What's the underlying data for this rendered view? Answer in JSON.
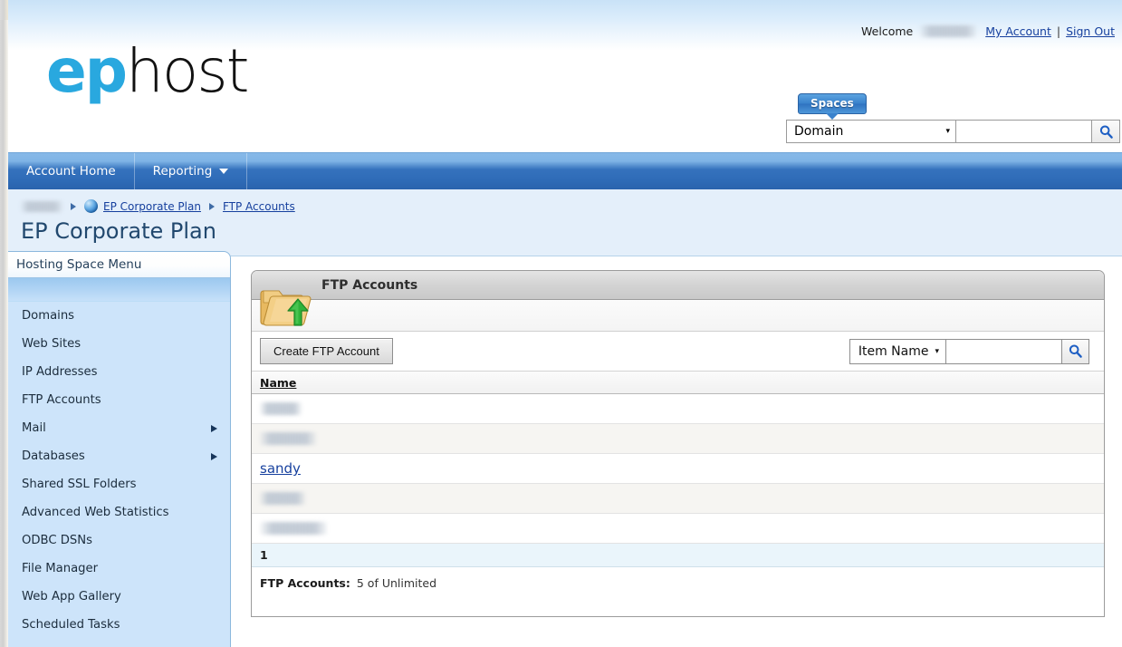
{
  "header": {
    "welcome_label": "Welcome",
    "welcome_user_redacted": "",
    "my_account_label": "My Account",
    "separator": "|",
    "sign_out_label": "Sign Out",
    "logo_part1": "ep",
    "logo_part2": "host",
    "brand_blue": "#29a8df"
  },
  "global_search": {
    "tab_label": "Spaces",
    "scope_value": "Domain",
    "scope_caret": "▾",
    "query_value": "",
    "query_placeholder": "",
    "search_icon": "magnifier-icon"
  },
  "nav": {
    "items": [
      {
        "label": "Account Home",
        "has_caret": false
      },
      {
        "label": "Reporting",
        "has_caret": true
      }
    ]
  },
  "breadcrumb": {
    "root_redacted": "",
    "globe_icon": "globe-icon",
    "items": [
      {
        "label": "EP Corporate Plan"
      },
      {
        "label": "FTP Accounts"
      }
    ]
  },
  "page_title": "EP Corporate Plan",
  "sidebar": {
    "title": "Hosting Space Menu",
    "items": [
      {
        "label": "Domains",
        "has_submenu": false
      },
      {
        "label": "Web Sites",
        "has_submenu": false
      },
      {
        "label": "IP Addresses",
        "has_submenu": false
      },
      {
        "label": "FTP Accounts",
        "has_submenu": false
      },
      {
        "label": "Mail",
        "has_submenu": true
      },
      {
        "label": "Databases",
        "has_submenu": true
      },
      {
        "label": "Shared SSL Folders",
        "has_submenu": false
      },
      {
        "label": "Advanced Web Statistics",
        "has_submenu": false
      },
      {
        "label": "ODBC DSNs",
        "has_submenu": false
      },
      {
        "label": "File Manager",
        "has_submenu": false
      },
      {
        "label": "Web App Gallery",
        "has_submenu": false
      },
      {
        "label": "Scheduled Tasks",
        "has_submenu": false
      }
    ]
  },
  "panel": {
    "title": "FTP Accounts",
    "icon": "folder-upload-icon",
    "create_button_label": "Create FTP Account",
    "filter": {
      "scope_value": "Item Name",
      "scope_caret": "▾",
      "query_value": "",
      "search_icon": "magnifier-icon"
    },
    "table": {
      "columns": [
        "Name"
      ],
      "rows": [
        {
          "name": "",
          "redacted": true,
          "redact_width": 46
        },
        {
          "name": "",
          "redacted": true,
          "redact_width": 62
        },
        {
          "name": "sandy",
          "redacted": false,
          "redact_width": 0
        },
        {
          "name": "",
          "redacted": true,
          "redact_width": 50
        },
        {
          "name": "",
          "redacted": true,
          "redact_width": 74
        }
      ]
    },
    "pager": {
      "current_page": "1"
    },
    "footer": {
      "label": "FTP Accounts:",
      "value": "5 of Unlimited"
    }
  }
}
